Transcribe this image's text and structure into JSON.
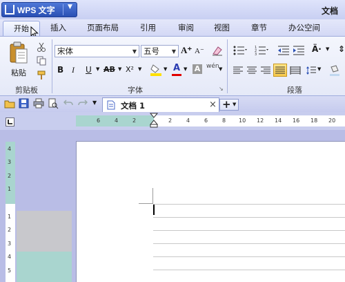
{
  "app": {
    "menu_button": "WPS 文字",
    "menu_arrow": "▼",
    "title_right": "文档"
  },
  "tabs": [
    "开始",
    "插入",
    "页面布局",
    "引用",
    "审阅",
    "视图",
    "章节",
    "办公空间"
  ],
  "ribbon": {
    "clipboard": {
      "paste_label": "粘贴",
      "group_label": "剪贴板"
    },
    "font": {
      "font_name": "宋体",
      "font_size": "五号",
      "group_label": "字体",
      "bold": "B",
      "italic": "I",
      "underline": "U",
      "strike": "AB",
      "superscript": "X²",
      "font_color": "A",
      "char_shading": "A",
      "grow": "A⁺",
      "shrink": "A⁻",
      "pinyin": "wén"
    },
    "paragraph": {
      "group_label": "段落"
    }
  },
  "qat": {
    "doc_tab": "文档 1",
    "close_glyph": "×",
    "new_tab": "+",
    "new_tab_arrow": "▼"
  },
  "ruler": {
    "h_ticks": [
      "6",
      "4",
      "2",
      "2",
      "4",
      "6",
      "8",
      "10",
      "12",
      "14",
      "16",
      "18",
      "20"
    ],
    "v_ticks_top": [
      "4",
      "3",
      "2",
      "1"
    ],
    "v_ticks_bottom": [
      "1",
      "2",
      "3",
      "4",
      "5"
    ]
  },
  "colors": {
    "accent": "#2a50b4",
    "ruler_margin": "#a9d5cf",
    "workspace": "#b9bde6",
    "highlight_yellow": "#ffe000",
    "font_color_red": "#e00000"
  }
}
